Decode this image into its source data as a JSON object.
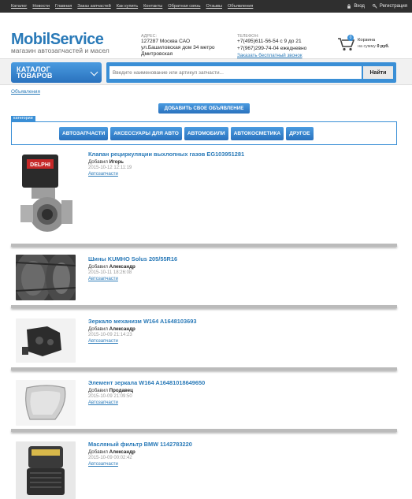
{
  "topnav": [
    "Каталог",
    "Новости",
    "Главная",
    "Заказ запчастей",
    "Как купить",
    "Контакты",
    "Обратная связь",
    "Отзывы",
    "Объявления"
  ],
  "auth": {
    "login": "Вход",
    "register": "Регистрация"
  },
  "logo": {
    "name": "MobilService",
    "tagline": "магазин автозапчастей и масел"
  },
  "address": {
    "label": "АДРЕС:",
    "line1": "127287 Москва САО",
    "line2": "ул.Башиловская дом 34 метро",
    "line3": "Дмитровская"
  },
  "phones": {
    "label": "ТЕЛЕФОН:",
    "line1": "+7(495)611-56-54 с 9 до 21",
    "line2": "+7(967)299-74-04 ежедневно",
    "callback": "Заказать бесплатный звонок"
  },
  "cart": {
    "count": "0",
    "label": "Корзина",
    "sum_prefix": "на сумму",
    "sum": "0 руб."
  },
  "catalog_button": {
    "line1": "КАТАЛОГ",
    "line2": "ТОВАРОВ"
  },
  "search": {
    "placeholder": "Введите наименование или артикул запчасти...",
    "button": "Найти"
  },
  "ads_link": "Объявления",
  "add_ad_button": "ДОБАВИТЬ СВОЕ ОБЪЯВЛЕНИЕ",
  "categories_tag": "категории",
  "categories": [
    "АВТОЗАПЧАСТИ",
    "АКСЕССУАРЫ ДЛЯ АВТО",
    "АВТОМОБИЛИ",
    "АВТОКОСМЕТИКА",
    "ДРУГОЕ"
  ],
  "listings": [
    {
      "title": "Клапан рециркуляции выхлопных газов EG103951281",
      "by_prefix": "Добавил",
      "author": "Игорь",
      "date": "2015-10-12 12:11:19",
      "category": "Автозапчасти"
    },
    {
      "title": "Шины KUMHO Solus 205/55R16",
      "by_prefix": "Добавил",
      "author": "Александр",
      "date": "2015-10-11 18:26:08",
      "category": "Автозапчасти"
    },
    {
      "title": "Зеркало механизм W164 A1648103693",
      "by_prefix": "Добавил",
      "author": "Александр",
      "date": "2015-10-09 21:14:23",
      "category": "Автозапчасти"
    },
    {
      "title": "Элемент зеркала W164 A16481018649650",
      "by_prefix": "Добавил",
      "author": "Продавец",
      "date": "2015-10-09 21:09:50",
      "category": "Автозапчасти"
    },
    {
      "title": "Масляный фильтр BMW 1142783220",
      "by_prefix": "Добавил",
      "author": "Александр",
      "date": "2015-10-09 00:02:42",
      "category": "Автозапчасти"
    }
  ],
  "thumb_brand": "DELPHI",
  "colors": {
    "accent": "#2a7ab8",
    "button": "#3a8fd6",
    "topbar": "#2f2f2f"
  }
}
